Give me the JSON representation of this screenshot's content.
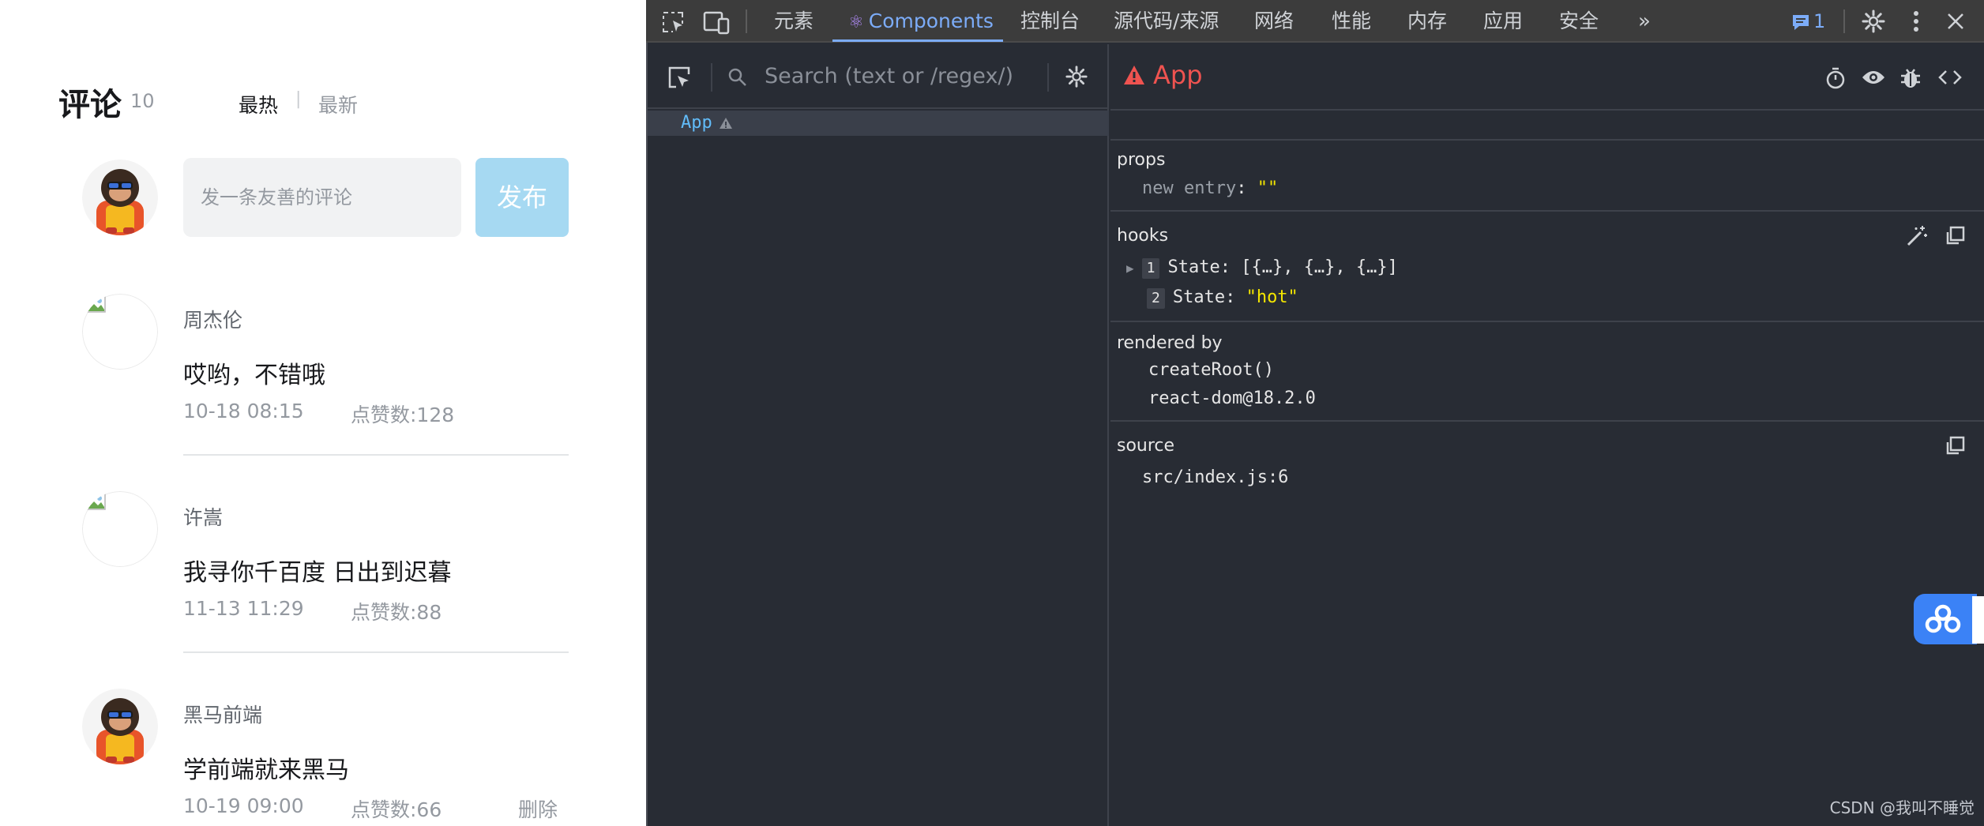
{
  "comment_app": {
    "title": "评论",
    "count": "10",
    "sort_hot": "最热",
    "sort_sep": "|",
    "sort_new": "最新",
    "input_placeholder": "发一条友善的评论",
    "publish_label": "发布",
    "comments": [
      {
        "user": "周杰伦",
        "text": "哎哟，不错哦",
        "time": "10-18 08:15",
        "likes": "点赞数:128",
        "delete": ""
      },
      {
        "user": "许嵩",
        "text": "我寻你千百度 日出到迟暮",
        "time": "11-13 11:29",
        "likes": "点赞数:88",
        "delete": ""
      },
      {
        "user": "黑马前端",
        "text": "学前端就来黑马",
        "time": "10-19 09:00",
        "likes": "点赞数:66",
        "delete": "删除"
      }
    ]
  },
  "devtools": {
    "tabs": [
      "元素",
      "Components",
      "控制台",
      "源代码/来源",
      "网络",
      "性能",
      "内存",
      "应用",
      "安全"
    ],
    "active_tab": "Components",
    "message_count": "1",
    "search_placeholder": "Search (text or /regex/)",
    "tree_item": "App",
    "inspector_title": "App",
    "props_title": "props",
    "props_key": "new entry",
    "props_value": "\"\"",
    "hooks_title": "hooks",
    "hook_1_index": "1",
    "hook_1_label": "State:",
    "hook_1_value": "[{…}, {…}, {…}]",
    "hook_2_index": "2",
    "hook_2_label": "State:",
    "hook_2_value": "\"hot\"",
    "rendered_by_title": "rendered by",
    "rendered_by_1": "createRoot()",
    "rendered_by_2": "react-dom@18.2.0",
    "source_title": "source",
    "source_value": "src/index.js:6",
    "colors": {
      "accent": "#7cacf8",
      "warning": "#ef5350",
      "string": "#f4e600",
      "tree_item": "#62bcf9"
    }
  },
  "watermark": "CSDN @我叫不睡觉"
}
